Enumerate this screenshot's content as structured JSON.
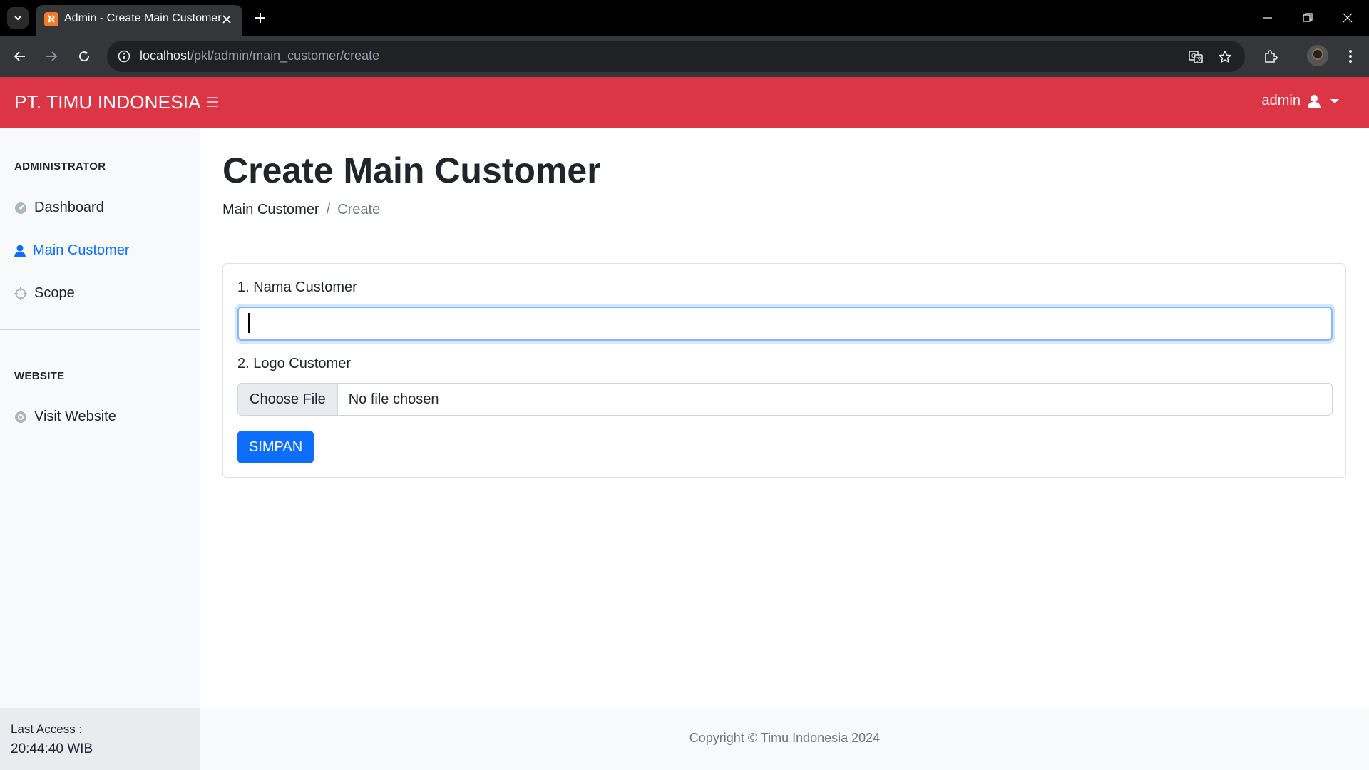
{
  "browser": {
    "tab_title": "Admin - Create Main Customer",
    "url_host": "localhost",
    "url_path": "/pkl/admin/main_customer/create"
  },
  "topbar": {
    "brand": "PT. TIMU INDONESIA",
    "user_name": "admin"
  },
  "sidebar": {
    "sections": [
      {
        "heading": "ADMINISTRATOR",
        "items": [
          {
            "label": "Dashboard",
            "icon": "dashboard-icon",
            "active": false
          },
          {
            "label": "Main Customer",
            "icon": "user-icon",
            "active": true
          },
          {
            "label": "Scope",
            "icon": "crosshair-icon",
            "active": false
          }
        ]
      },
      {
        "heading": "WEBSITE",
        "items": [
          {
            "label": "Visit Website",
            "icon": "globe-icon",
            "active": false
          }
        ]
      }
    ],
    "last_access_label": "Last Access :",
    "last_access_time": "20:44:40 WIB"
  },
  "page": {
    "title": "Create Main Customer",
    "breadcrumb": [
      "Main Customer",
      "/",
      "Create"
    ]
  },
  "form": {
    "field1_label": "1. Nama Customer",
    "field1_value": "",
    "field2_label": "2. Logo Customer",
    "file_button": "Choose File",
    "file_status": "No file chosen",
    "submit_label": "SIMPAN"
  },
  "footer": {
    "copyright": "Copyright © Timu Indonesia 2024"
  },
  "colors": {
    "topbar": "#dc3545",
    "accent": "#0d6efd",
    "sidebar_bg": "#f8f9fa"
  }
}
